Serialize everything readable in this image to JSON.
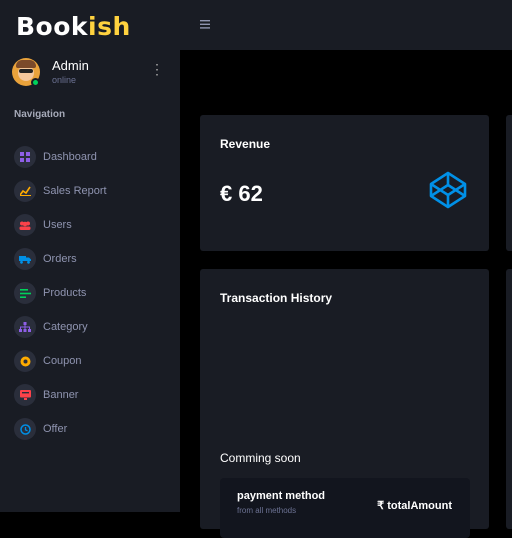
{
  "brand": {
    "main": "Book",
    "accent": "ish"
  },
  "profile": {
    "name": "Admin",
    "status": "online"
  },
  "nav": {
    "heading": "Navigation",
    "items": [
      {
        "label": "Dashboard",
        "icon": "grid-icon",
        "color": "#8f5fe8"
      },
      {
        "label": "Sales Report",
        "icon": "chart-icon",
        "color": "#ffab00"
      },
      {
        "label": "Users",
        "icon": "users-icon",
        "color": "#fc424a"
      },
      {
        "label": "Orders",
        "icon": "truck-icon",
        "color": "#0090e7"
      },
      {
        "label": "Products",
        "icon": "list-icon",
        "color": "#00d25b"
      },
      {
        "label": "Category",
        "icon": "sitemap-icon",
        "color": "#8f5fe8"
      },
      {
        "label": "Coupon",
        "icon": "badge-icon",
        "color": "#ffab00"
      },
      {
        "label": "Banner",
        "icon": "image-icon",
        "color": "#fc424a"
      },
      {
        "label": "Offer",
        "icon": "clock-icon",
        "color": "#0090e7"
      }
    ]
  },
  "revenue": {
    "title": "Revenue",
    "value": "€ 62"
  },
  "transactions": {
    "title": "Transaction History",
    "soon": "Comming soon",
    "payment_label": "payment method",
    "payment_sub": "from all methods",
    "total_label": "₹ totalAmount"
  }
}
